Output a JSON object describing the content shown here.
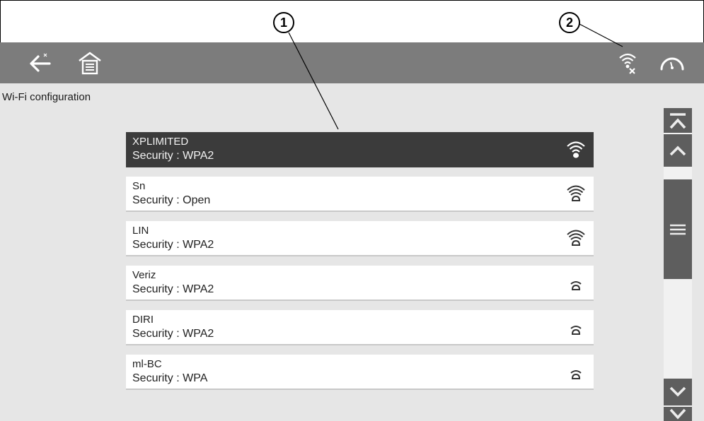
{
  "callouts": {
    "one": "1",
    "two": "2"
  },
  "toolbar": {
    "back_icon": "back-arrow-icon",
    "home_icon": "home-icon",
    "wifi_status_icon": "wifi-disconnected-icon",
    "gauge_icon": "gauge-icon"
  },
  "page": {
    "title": "Wi-Fi configuration"
  },
  "networks": [
    {
      "ssid": "XPLIMITED",
      "security": "Security : WPA2",
      "signal_icon": "wifi-signal-strong-icon",
      "selected": true
    },
    {
      "ssid": "Sn",
      "security": "Security : Open",
      "signal_icon": "wifi-signal-strong-icon",
      "selected": false
    },
    {
      "ssid": "LIN",
      "security": "Security : WPA2",
      "signal_icon": "wifi-signal-strong-icon",
      "selected": false
    },
    {
      "ssid": "Veriz",
      "security": "Security : WPA2",
      "signal_icon": "wifi-signal-weak-icon",
      "selected": false
    },
    {
      "ssid": "DIRI",
      "security": "Security : WPA2",
      "signal_icon": "wifi-signal-weak-icon",
      "selected": false
    },
    {
      "ssid": "ml-BC",
      "security": "Security : WPA",
      "signal_icon": "wifi-signal-weak-icon",
      "selected": false
    }
  ],
  "scrollbar": {
    "top_icon": "scroll-to-top-icon",
    "up_icon": "scroll-up-icon",
    "thumb_icon": "scroll-thumb-grip-icon",
    "down_icon": "scroll-down-icon",
    "bottom_icon": "scroll-to-bottom-icon"
  },
  "colors": {
    "toolbar_bg": "#7c7c7c",
    "screen_bg": "#e6e6e6",
    "selected_row_bg": "#3b3b3b",
    "scroll_button_bg": "#5e5e5e"
  }
}
